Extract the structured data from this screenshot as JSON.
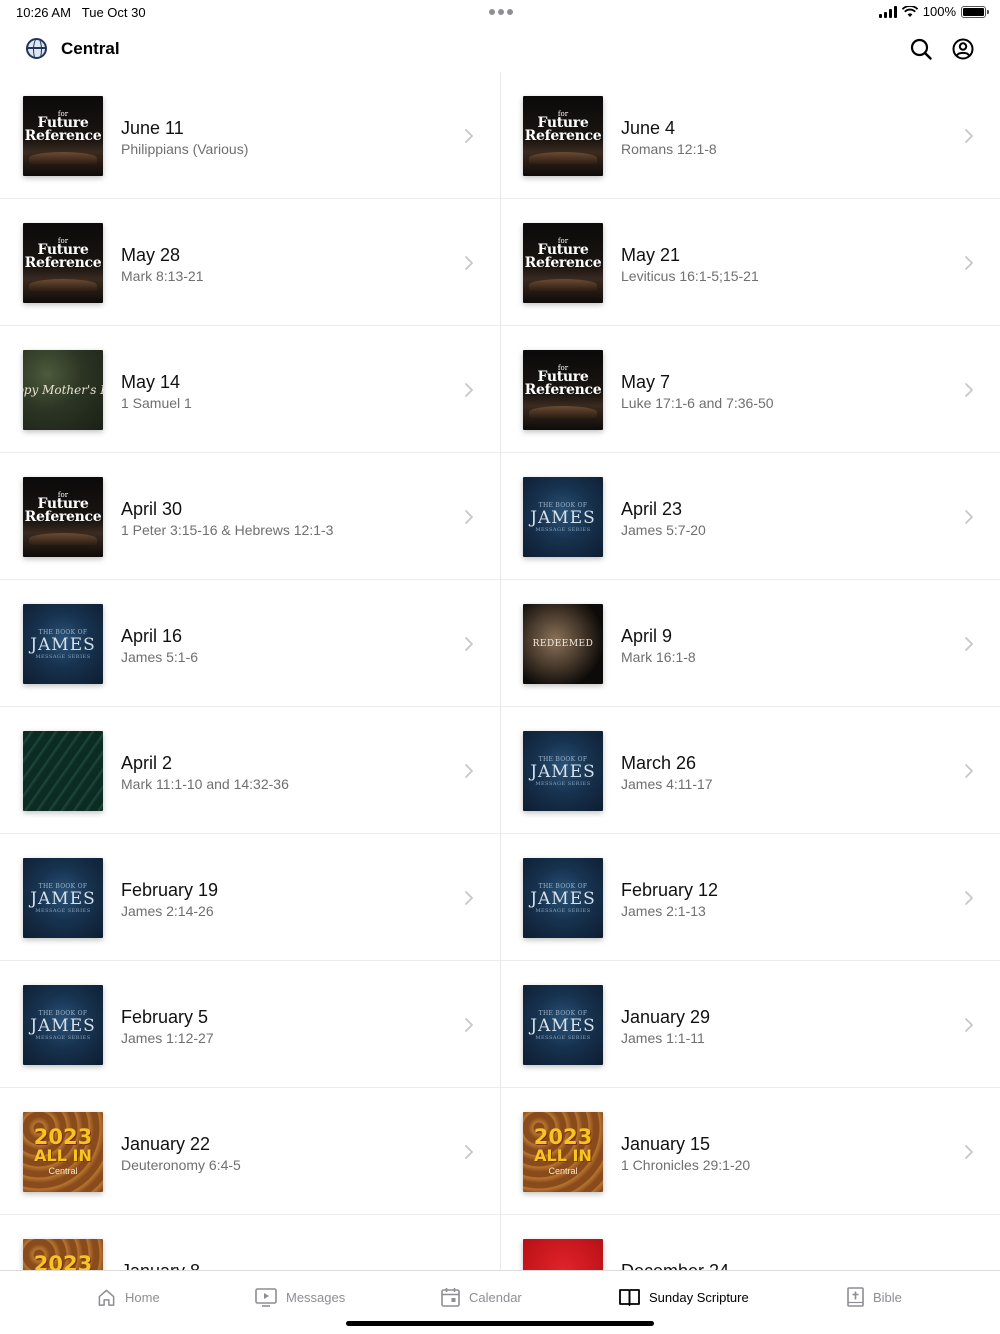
{
  "status_bar": {
    "time": "10:26 AM",
    "date": "Tue Oct 30",
    "battery": "100%"
  },
  "header": {
    "title": "Central",
    "icons": [
      "globe-icon",
      "search-icon",
      "account-icon"
    ]
  },
  "items": [
    {
      "title": "June 11",
      "subtitle": "Philippians (Various)",
      "thumb": "ffr"
    },
    {
      "title": "June 4",
      "subtitle": "Romans 12:1-8",
      "thumb": "ffr"
    },
    {
      "title": "May 28",
      "subtitle": "Mark 8:13-21",
      "thumb": "ffr"
    },
    {
      "title": "May 21",
      "subtitle": "Leviticus 16:1-5;15-21",
      "thumb": "ffr"
    },
    {
      "title": "May 14",
      "subtitle": "1 Samuel 1",
      "thumb": "moss"
    },
    {
      "title": "May 7",
      "subtitle": "Luke 17:1-6 and 7:36-50",
      "thumb": "ffr"
    },
    {
      "title": "April 30",
      "subtitle": "1 Peter 3:15-16 & Hebrews 12:1-3",
      "thumb": "ffr"
    },
    {
      "title": "April 23",
      "subtitle": "James 5:7-20",
      "thumb": "james"
    },
    {
      "title": "April 16",
      "subtitle": "James 5:1-6",
      "thumb": "james"
    },
    {
      "title": "April 9",
      "subtitle": "Mark 16:1-8",
      "thumb": "moon"
    },
    {
      "title": "April 2",
      "subtitle": "Mark 11:1-10 and 14:32-36",
      "thumb": "leaves"
    },
    {
      "title": "March 26",
      "subtitle": "James 4:11-17",
      "thumb": "james"
    },
    {
      "title": "February 19",
      "subtitle": "James 2:14-26",
      "thumb": "james"
    },
    {
      "title": "February 12",
      "subtitle": "James 2:1-13",
      "thumb": "james"
    },
    {
      "title": "February 5",
      "subtitle": "James 1:12-27",
      "thumb": "james"
    },
    {
      "title": "January 29",
      "subtitle": "James 1:1-11",
      "thumb": "james"
    },
    {
      "title": "January 22",
      "subtitle": "Deuteronomy 6:4-5",
      "thumb": "allin"
    },
    {
      "title": "January 15",
      "subtitle": "1 Chronicles 29:1-20",
      "thumb": "allin"
    },
    {
      "title": "January 8",
      "subtitle": "",
      "thumb": "allin"
    },
    {
      "title": "December 24",
      "subtitle": "",
      "thumb": "red"
    }
  ],
  "thumb_text": {
    "ffr": {
      "for": "for",
      "line1": "Future",
      "line2": "Reference"
    },
    "james": {
      "line1": "THE BOOK OF",
      "line2": "JAMES",
      "line3": "MESSAGE SERIES"
    },
    "moss": {
      "line1": "ppy Mother's D"
    },
    "moon": {
      "line1": "REDEEMED"
    },
    "allin": {
      "line1": "2023",
      "line2": "ALL IN",
      "line3": "Central"
    }
  },
  "tabs": [
    {
      "label": "Home",
      "icon": "home-icon",
      "active": false
    },
    {
      "label": "Messages",
      "icon": "play-screen-icon",
      "active": false
    },
    {
      "label": "Calendar",
      "icon": "calendar-icon",
      "active": false
    },
    {
      "label": "Sunday Scripture",
      "icon": "open-book-icon",
      "active": true
    },
    {
      "label": "Bible",
      "icon": "bible-icon",
      "active": false
    }
  ],
  "colors": {
    "accent": "#000000",
    "inactive_tab": "#8e8e93",
    "subtitle": "#6f6f6f"
  }
}
